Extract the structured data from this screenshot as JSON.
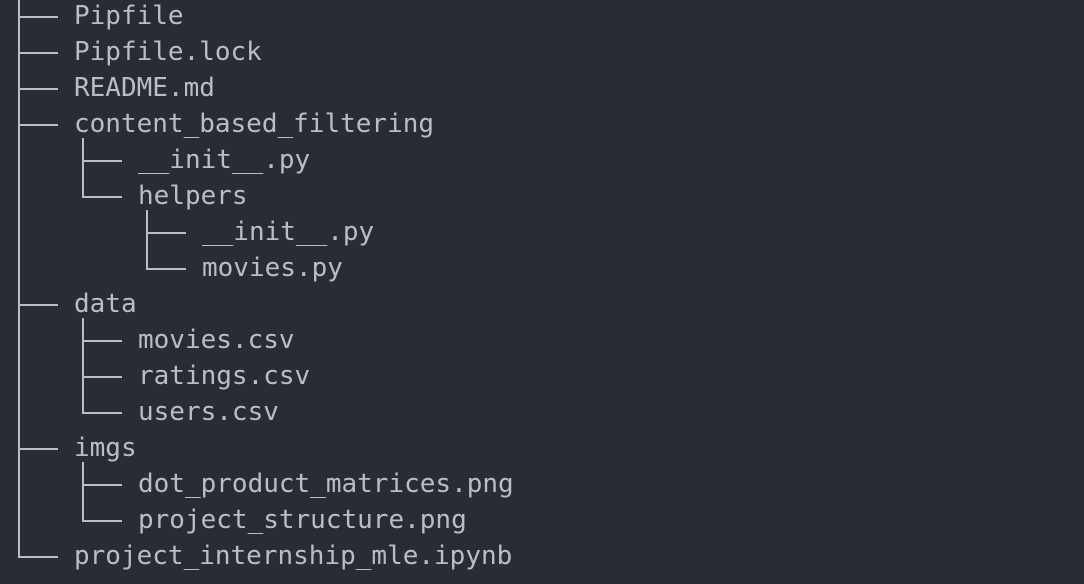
{
  "tree": {
    "items": [
      {
        "name": "Pipfile",
        "depth": 0,
        "last": false
      },
      {
        "name": "Pipfile.lock",
        "depth": 0,
        "last": false
      },
      {
        "name": "README.md",
        "depth": 0,
        "last": false
      },
      {
        "name": "content_based_filtering",
        "depth": 0,
        "last": false
      },
      {
        "name": "__init__.py",
        "depth": 1,
        "last": false
      },
      {
        "name": "helpers",
        "depth": 1,
        "last": true
      },
      {
        "name": "__init__.py",
        "depth": 2,
        "last": false
      },
      {
        "name": "movies.py",
        "depth": 2,
        "last": true
      },
      {
        "name": "data",
        "depth": 0,
        "last": false
      },
      {
        "name": "movies.csv",
        "depth": 1,
        "last": false
      },
      {
        "name": "ratings.csv",
        "depth": 1,
        "last": false
      },
      {
        "name": "users.csv",
        "depth": 1,
        "last": true
      },
      {
        "name": "imgs",
        "depth": 0,
        "last": false
      },
      {
        "name": "dot_product_matrices.png",
        "depth": 1,
        "last": false
      },
      {
        "name": "project_structure.png",
        "depth": 1,
        "last": true
      },
      {
        "name": "project_internship_mle.ipynb",
        "depth": 0,
        "last": true
      }
    ]
  }
}
